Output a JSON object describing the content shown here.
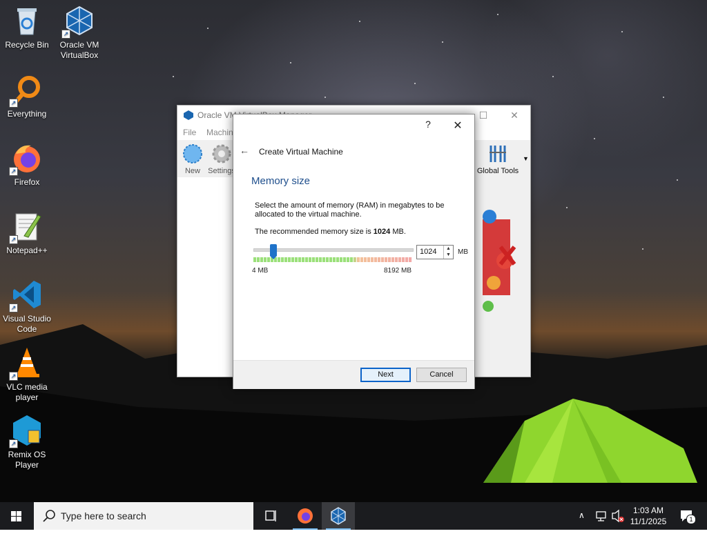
{
  "desktop": {
    "icons": [
      {
        "label": "Recycle Bin",
        "icon": "recycle-bin-icon"
      },
      {
        "label": "Oracle VM VirtualBox",
        "icon": "virtualbox-icon"
      },
      {
        "label": "Everything",
        "icon": "everything-search-icon"
      },
      {
        "label": "Firefox",
        "icon": "firefox-icon"
      },
      {
        "label": "Notepad++",
        "icon": "notepadplusplus-icon"
      },
      {
        "label": "Visual Studio Code",
        "icon": "vscode-icon"
      },
      {
        "label": "VLC media player",
        "icon": "vlc-icon"
      },
      {
        "label": "Remix OS Player",
        "icon": "remix-os-icon"
      }
    ]
  },
  "manager": {
    "title": "Oracle VM VirtualBox Manager",
    "menu": [
      "File",
      "Machine"
    ],
    "toolbar": {
      "new": "New",
      "settings": "Settings",
      "global_tools": "Global Tools"
    }
  },
  "dialog": {
    "help": "?",
    "close": "✕",
    "wizard_title": "Create Virtual Machine",
    "page_title": "Memory size",
    "description": "Select the amount of memory (RAM) in megabytes to be allocated to the virtual machine.",
    "recommended_prefix": "The recommended memory size is ",
    "recommended_value": "1024",
    "recommended_suffix": " MB.",
    "slider": {
      "min_label": "4 MB",
      "max_label": "8192 MB",
      "min": 4,
      "max": 8192,
      "value": 1024
    },
    "spin_value": "1024",
    "unit": "MB",
    "next": "Next",
    "cancel": "Cancel"
  },
  "taskbar": {
    "search_placeholder": "Type here to search",
    "time": "1:03 AM",
    "date": "11/1/2025",
    "notification_count": "1"
  },
  "colors": {
    "accent": "#1f72c9",
    "dialog_heading": "#1e4e8c",
    "taskbar": "#1b1c1f"
  }
}
